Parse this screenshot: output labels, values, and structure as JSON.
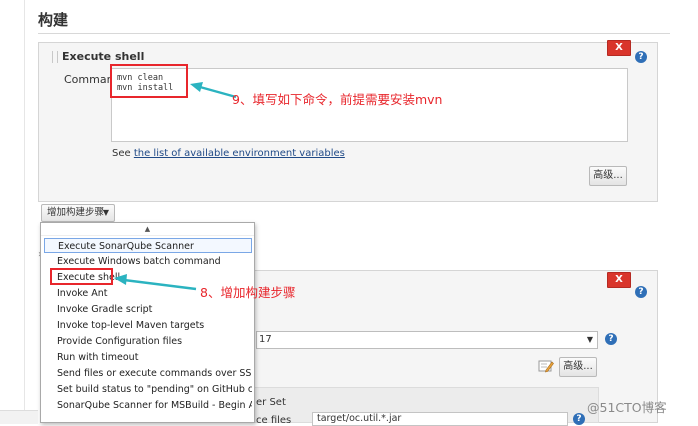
{
  "section": {
    "title": "构建"
  },
  "step1": {
    "title": "Execute shell",
    "remove_label": "X",
    "help_label": "?",
    "command_label": "Command",
    "command_value": "mvn clean\nmvn install",
    "see_prefix": "See ",
    "see_link": "the list of available environment variables",
    "advanced_label": "高级..."
  },
  "add_step": {
    "label": "增加构建步骤",
    "caret": "▼"
  },
  "dropdown": {
    "scroll_up": "▲",
    "items": [
      "Execute SonarQube Scanner",
      "Execute Windows batch command",
      "Execute shell",
      "Invoke Ant",
      "Invoke Gradle script",
      "Invoke top-level Maven targets",
      "Provide Configuration files",
      "Run with timeout",
      "Send files or execute commands over SSH",
      "Set build status to \"pending\" on GitHub commit",
      "SonarQube Scanner for MSBuild - Begin Analysis"
    ]
  },
  "annotations": {
    "note1": "9、填写如下命令，前提需要安装mvn",
    "note2": "8、增加构建步骤"
  },
  "step2": {
    "remove_label": "X",
    "help_label": "?",
    "select_value": "17",
    "select_caret": "▼",
    "advanced_label": "高级...",
    "peek_text_1": "er Set",
    "peek_text_2": "ce files",
    "field_value": "target/oc.util.*.jar"
  },
  "bullet": "»",
  "watermark": "@51CTO博客",
  "colors": {
    "accent_red": "#e8262c",
    "link_blue": "#204a87",
    "remove_red": "#d9352b"
  },
  "icons": [
    "drag-handle-icon",
    "help-icon",
    "edit-icon",
    "chevron-down-icon",
    "arrow-icon"
  ]
}
